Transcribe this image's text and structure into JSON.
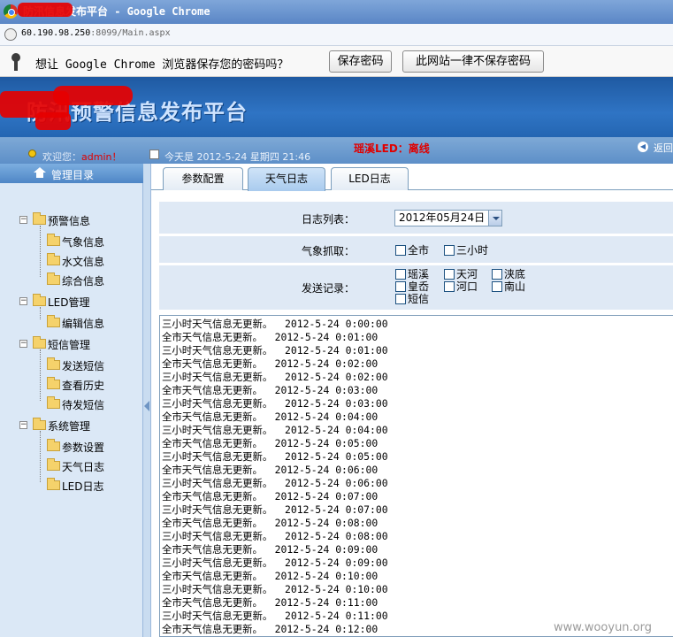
{
  "window": {
    "title": "防汛信息发布平台 - Google Chrome",
    "title_visible": "防汛信息发布平台 - Google Chrome"
  },
  "address_bar": {
    "host": "60.190.98.250",
    "path": ":8099/Main.aspx"
  },
  "password_bar": {
    "prompt": "想让 Google Chrome 浏览器保存您的密码吗？",
    "save_label": "保存密码",
    "never_label": "此网站一律不保存密码"
  },
  "banner": {
    "title": "防汛预警信息发布平台"
  },
  "info_bar": {
    "welcome_prefix": "欢迎您：",
    "username": "admin！",
    "today": "今天是 2012-5-24 星期四 21:46",
    "led_status": "瑶溪LED：离线",
    "back_label": "返回"
  },
  "sidebar": {
    "title": "管理目录",
    "groups": [
      {
        "label": "预警信息",
        "items": [
          "气象信息",
          "水文信息",
          "综合信息"
        ]
      },
      {
        "label": "LED管理",
        "items": [
          "编辑信息"
        ]
      },
      {
        "label": "短信管理",
        "items": [
          "发送短信",
          "查看历史",
          "待发短信"
        ]
      },
      {
        "label": "系统管理",
        "items": [
          "参数设置",
          "天气日志",
          "LED日志"
        ]
      }
    ]
  },
  "tabs": [
    {
      "label": "参数配置",
      "active": false
    },
    {
      "label": "天气日志",
      "active": true
    },
    {
      "label": "LED日志",
      "active": false
    }
  ],
  "form": {
    "log_list_label": "日志列表：",
    "log_list_value": "2012年05月24日",
    "fetch_label": "气象抓取：",
    "fetch_options": [
      "全市",
      "三小时"
    ],
    "send_label": "发送记录：",
    "send_options": [
      "瑶溪",
      "天河",
      "浃底",
      "皇岙",
      "河口",
      "南山",
      "短信"
    ]
  },
  "log_lines": [
    "三小时天气信息无更新。  2012-5-24 0:00:00",
    "全市天气信息无更新。  2012-5-24 0:01:00",
    "三小时天气信息无更新。  2012-5-24 0:01:00",
    "全市天气信息无更新。  2012-5-24 0:02:00",
    "三小时天气信息无更新。  2012-5-24 0:02:00",
    "全市天气信息无更新。  2012-5-24 0:03:00",
    "三小时天气信息无更新。  2012-5-24 0:03:00",
    "全市天气信息无更新。  2012-5-24 0:04:00",
    "三小时天气信息无更新。  2012-5-24 0:04:00",
    "全市天气信息无更新。  2012-5-24 0:05:00",
    "三小时天气信息无更新。  2012-5-24 0:05:00",
    "全市天气信息无更新。  2012-5-24 0:06:00",
    "三小时天气信息无更新。  2012-5-24 0:06:00",
    "全市天气信息无更新。  2012-5-24 0:07:00",
    "三小时天气信息无更新。  2012-5-24 0:07:00",
    "全市天气信息无更新。  2012-5-24 0:08:00",
    "三小时天气信息无更新。  2012-5-24 0:08:00",
    "全市天气信息无更新。  2012-5-24 0:09:00",
    "三小时天气信息无更新。  2012-5-24 0:09:00",
    "全市天气信息无更新。  2012-5-24 0:10:00",
    "三小时天气信息无更新。  2012-5-24 0:10:00",
    "全市天气信息无更新。  2012-5-24 0:11:00",
    "三小时天气信息无更新。  2012-5-24 0:11:00",
    "全市天气信息无更新。  2012-5-24 0:12:00"
  ],
  "watermark": "www.wooyun.org",
  "colors": {
    "banner": "#2f74c4",
    "sidebar": "#dbe8f6",
    "form_row": "#dfe9f5",
    "alert_red": "#e00000"
  }
}
